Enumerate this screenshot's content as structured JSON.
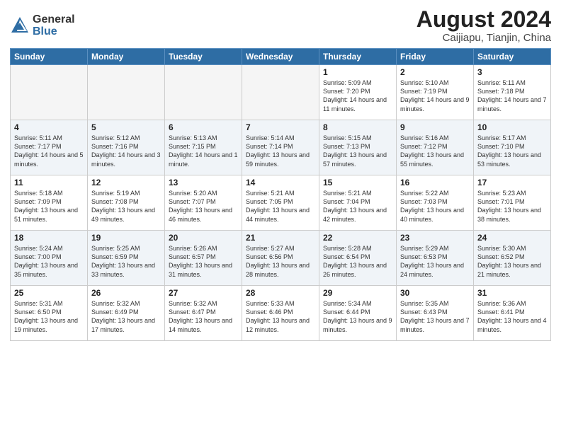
{
  "header": {
    "logo_general": "General",
    "logo_blue": "Blue",
    "month_title": "August 2024",
    "location": "Caijiapu, Tianjin, China"
  },
  "weekdays": [
    "Sunday",
    "Monday",
    "Tuesday",
    "Wednesday",
    "Thursday",
    "Friday",
    "Saturday"
  ],
  "weeks": [
    [
      {
        "day": "",
        "info": ""
      },
      {
        "day": "",
        "info": ""
      },
      {
        "day": "",
        "info": ""
      },
      {
        "day": "",
        "info": ""
      },
      {
        "day": "1",
        "info": "Sunrise: 5:09 AM\nSunset: 7:20 PM\nDaylight: 14 hours\nand 11 minutes."
      },
      {
        "day": "2",
        "info": "Sunrise: 5:10 AM\nSunset: 7:19 PM\nDaylight: 14 hours\nand 9 minutes."
      },
      {
        "day": "3",
        "info": "Sunrise: 5:11 AM\nSunset: 7:18 PM\nDaylight: 14 hours\nand 7 minutes."
      }
    ],
    [
      {
        "day": "4",
        "info": "Sunrise: 5:11 AM\nSunset: 7:17 PM\nDaylight: 14 hours\nand 5 minutes."
      },
      {
        "day": "5",
        "info": "Sunrise: 5:12 AM\nSunset: 7:16 PM\nDaylight: 14 hours\nand 3 minutes."
      },
      {
        "day": "6",
        "info": "Sunrise: 5:13 AM\nSunset: 7:15 PM\nDaylight: 14 hours\nand 1 minute."
      },
      {
        "day": "7",
        "info": "Sunrise: 5:14 AM\nSunset: 7:14 PM\nDaylight: 13 hours\nand 59 minutes."
      },
      {
        "day": "8",
        "info": "Sunrise: 5:15 AM\nSunset: 7:13 PM\nDaylight: 13 hours\nand 57 minutes."
      },
      {
        "day": "9",
        "info": "Sunrise: 5:16 AM\nSunset: 7:12 PM\nDaylight: 13 hours\nand 55 minutes."
      },
      {
        "day": "10",
        "info": "Sunrise: 5:17 AM\nSunset: 7:10 PM\nDaylight: 13 hours\nand 53 minutes."
      }
    ],
    [
      {
        "day": "11",
        "info": "Sunrise: 5:18 AM\nSunset: 7:09 PM\nDaylight: 13 hours\nand 51 minutes."
      },
      {
        "day": "12",
        "info": "Sunrise: 5:19 AM\nSunset: 7:08 PM\nDaylight: 13 hours\nand 49 minutes."
      },
      {
        "day": "13",
        "info": "Sunrise: 5:20 AM\nSunset: 7:07 PM\nDaylight: 13 hours\nand 46 minutes."
      },
      {
        "day": "14",
        "info": "Sunrise: 5:21 AM\nSunset: 7:05 PM\nDaylight: 13 hours\nand 44 minutes."
      },
      {
        "day": "15",
        "info": "Sunrise: 5:21 AM\nSunset: 7:04 PM\nDaylight: 13 hours\nand 42 minutes."
      },
      {
        "day": "16",
        "info": "Sunrise: 5:22 AM\nSunset: 7:03 PM\nDaylight: 13 hours\nand 40 minutes."
      },
      {
        "day": "17",
        "info": "Sunrise: 5:23 AM\nSunset: 7:01 PM\nDaylight: 13 hours\nand 38 minutes."
      }
    ],
    [
      {
        "day": "18",
        "info": "Sunrise: 5:24 AM\nSunset: 7:00 PM\nDaylight: 13 hours\nand 35 minutes."
      },
      {
        "day": "19",
        "info": "Sunrise: 5:25 AM\nSunset: 6:59 PM\nDaylight: 13 hours\nand 33 minutes."
      },
      {
        "day": "20",
        "info": "Sunrise: 5:26 AM\nSunset: 6:57 PM\nDaylight: 13 hours\nand 31 minutes."
      },
      {
        "day": "21",
        "info": "Sunrise: 5:27 AM\nSunset: 6:56 PM\nDaylight: 13 hours\nand 28 minutes."
      },
      {
        "day": "22",
        "info": "Sunrise: 5:28 AM\nSunset: 6:54 PM\nDaylight: 13 hours\nand 26 minutes."
      },
      {
        "day": "23",
        "info": "Sunrise: 5:29 AM\nSunset: 6:53 PM\nDaylight: 13 hours\nand 24 minutes."
      },
      {
        "day": "24",
        "info": "Sunrise: 5:30 AM\nSunset: 6:52 PM\nDaylight: 13 hours\nand 21 minutes."
      }
    ],
    [
      {
        "day": "25",
        "info": "Sunrise: 5:31 AM\nSunset: 6:50 PM\nDaylight: 13 hours\nand 19 minutes."
      },
      {
        "day": "26",
        "info": "Sunrise: 5:32 AM\nSunset: 6:49 PM\nDaylight: 13 hours\nand 17 minutes."
      },
      {
        "day": "27",
        "info": "Sunrise: 5:32 AM\nSunset: 6:47 PM\nDaylight: 13 hours\nand 14 minutes."
      },
      {
        "day": "28",
        "info": "Sunrise: 5:33 AM\nSunset: 6:46 PM\nDaylight: 13 hours\nand 12 minutes."
      },
      {
        "day": "29",
        "info": "Sunrise: 5:34 AM\nSunset: 6:44 PM\nDaylight: 13 hours\nand 9 minutes."
      },
      {
        "day": "30",
        "info": "Sunrise: 5:35 AM\nSunset: 6:43 PM\nDaylight: 13 hours\nand 7 minutes."
      },
      {
        "day": "31",
        "info": "Sunrise: 5:36 AM\nSunset: 6:41 PM\nDaylight: 13 hours\nand 4 minutes."
      }
    ]
  ]
}
